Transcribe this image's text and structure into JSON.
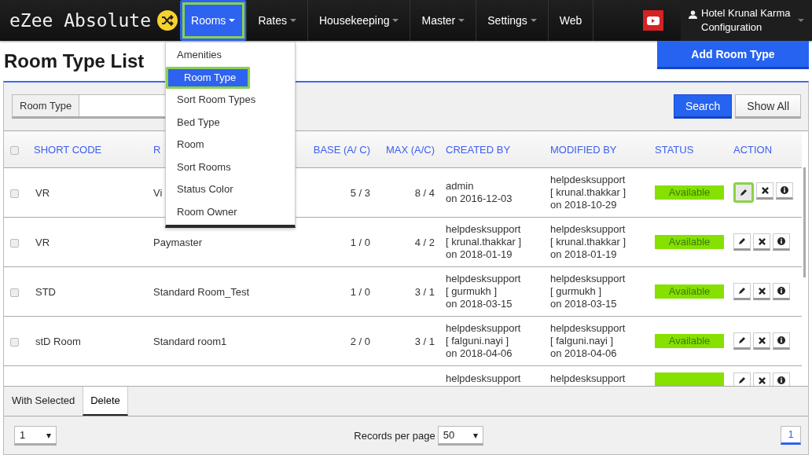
{
  "brand": {
    "name": "eZee Absolute"
  },
  "nav": [
    {
      "label": "Rooms",
      "selected": true,
      "highlighted": true,
      "caret": true
    },
    {
      "label": "Rates",
      "selected": false,
      "highlighted": false,
      "caret": true
    },
    {
      "label": "Housekeeping",
      "selected": false,
      "highlighted": false,
      "caret": true
    },
    {
      "label": "Master",
      "selected": false,
      "highlighted": false,
      "caret": true
    },
    {
      "label": "Settings",
      "selected": false,
      "highlighted": false,
      "caret": true
    },
    {
      "label": "Web",
      "selected": false,
      "highlighted": false,
      "caret": false
    }
  ],
  "user": {
    "hotel": "Hotel Krunal Karma",
    "role": "Configuration"
  },
  "menu": [
    {
      "label": "Amenities",
      "selected": false,
      "highlighted": false
    },
    {
      "label": "Room Type",
      "selected": true,
      "highlighted": true
    },
    {
      "label": "Sort Room Types",
      "selected": false,
      "highlighted": false
    },
    {
      "label": "Bed Type",
      "selected": false,
      "highlighted": false
    },
    {
      "label": "Room",
      "selected": false,
      "highlighted": false
    },
    {
      "label": "Sort Rooms",
      "selected": false,
      "highlighted": false
    },
    {
      "label": "Status Color",
      "selected": false,
      "highlighted": false
    },
    {
      "label": "Room Owner",
      "selected": false,
      "highlighted": false
    }
  ],
  "page_title": "Room Type List",
  "add_button": "Add Room Type",
  "search": {
    "label": "Room Type",
    "search_button": "Search",
    "show_all_button": "Show All"
  },
  "table": {
    "all_checked": false,
    "columns": [
      "SHORT CODE",
      "R",
      "BASE (A/ C)",
      "MAX (A/C)",
      "CREATED BY",
      "MODIFIED BY",
      "STATUS",
      "ACTION"
    ],
    "rows": [
      {
        "checked": false,
        "short_code": "VR",
        "name": "Vi",
        "base": "5 / 3",
        "max": "8 / 4",
        "created": [
          "admin",
          "on 2016-12-03"
        ],
        "modified": [
          "helpdesksupport",
          "[ krunal.thakkar ]",
          "on 2018-10-29"
        ],
        "status": "Available",
        "edit_highlighted": true
      },
      {
        "checked": false,
        "short_code": "VR",
        "name": "Paymaster",
        "base": "1 / 0",
        "max": "4 / 2",
        "created": [
          "helpdesksupport",
          "[ krunal.thakkar ]",
          "on 2018-01-19"
        ],
        "modified": [
          "helpdesksupport",
          "[ krunal.thakkar ]",
          "on 2018-01-19"
        ],
        "status": "Available",
        "edit_highlighted": false
      },
      {
        "checked": false,
        "short_code": "STD",
        "name": "Standard Room_Test",
        "base": "1 / 0",
        "max": "3 / 1",
        "created": [
          "helpdesksupport",
          "[ gurmukh ]",
          "on 2018-03-15"
        ],
        "modified": [
          "helpdesksupport",
          "[ gurmukh ]",
          "on 2018-03-15"
        ],
        "status": "Available",
        "edit_highlighted": false
      },
      {
        "checked": false,
        "short_code": "stD Room",
        "name": "Standard room1",
        "base": "2 / 0",
        "max": "3 / 1",
        "created": [
          "helpdesksupport",
          "[ falguni.nayi ]",
          "on 2018-04-06"
        ],
        "modified": [
          "helpdesksupport",
          "[ falguni.nayi ]",
          "on 2018-04-06"
        ],
        "status": "Available",
        "edit_highlighted": false
      },
      {
        "cut": true,
        "created": [
          "helpdesksupport"
        ],
        "modified": [
          "helpdesksupport"
        ],
        "edit_highlighted": false
      }
    ]
  },
  "footer": {
    "with_selected": "With Selected",
    "delete": "Delete",
    "page_select": "1",
    "records_label": "Records per page",
    "records_select": "50",
    "pages": [
      {
        "label": "1",
        "selected": true
      }
    ]
  }
}
